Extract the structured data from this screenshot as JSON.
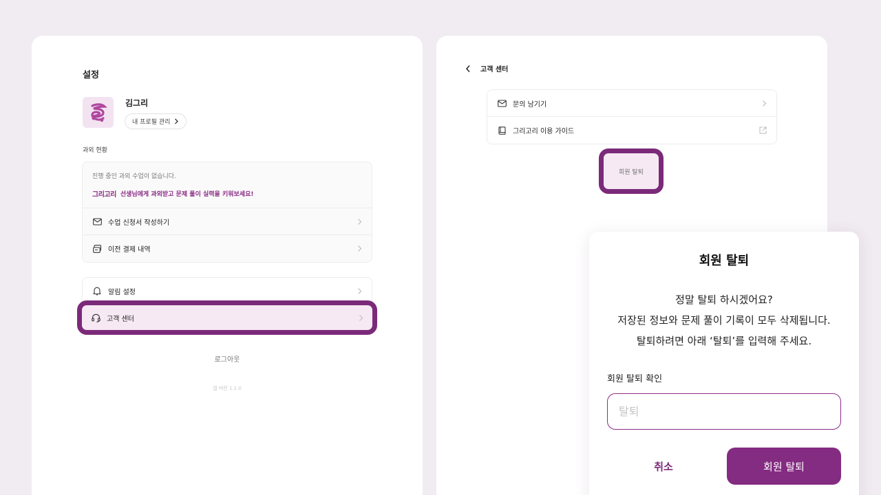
{
  "settings": {
    "title": "설정",
    "user_name": "김그리",
    "profile_button": "내 프로필 관리",
    "lessons_section_label": "과외 현황",
    "no_lessons": "진행 중인 과외 수업이 없습니다.",
    "promo_logo": "그리고리",
    "promo_text": "선생님에게 과외받고 문제 풀이 실력을 키워보세요!",
    "lesson_menu": [
      {
        "label": "수업 신청서 작성하기",
        "icon": "mail-icon"
      },
      {
        "label": "이전 결제 내역",
        "icon": "receipt-icon"
      }
    ],
    "notification_label": "알림 설정",
    "support_label": "고객 센터",
    "logout": "로그아웃",
    "version": "앱 버전 1.1.0"
  },
  "support": {
    "title": "고객 센터",
    "items": [
      {
        "label": "문의 남기기",
        "icon": "mail-icon",
        "trail": "chevron-right-icon"
      },
      {
        "label": "그리고리 이용 가이드",
        "icon": "book-icon",
        "trail": "external-link-icon"
      }
    ],
    "withdraw": "회원 탈퇴"
  },
  "modal": {
    "title": "회원 탈퇴",
    "line1": "정말 탈퇴 하시겠어요?",
    "line2": "저장된 정보와 문제 풀이 기록이 모두 삭제됩니다.",
    "line3": "탈퇴하려면 아래 ‘탈퇴’를 입력해 주세요.",
    "field_label": "회원 탈퇴 확인",
    "placeholder": "탈퇴",
    "cancel": "취소",
    "confirm": "회원 탈퇴"
  },
  "colors": {
    "accent": "#842b82",
    "highlight_border": "#7b2a7a",
    "highlight_fill": "#f6e9f3",
    "background": "#f1ecf1"
  }
}
